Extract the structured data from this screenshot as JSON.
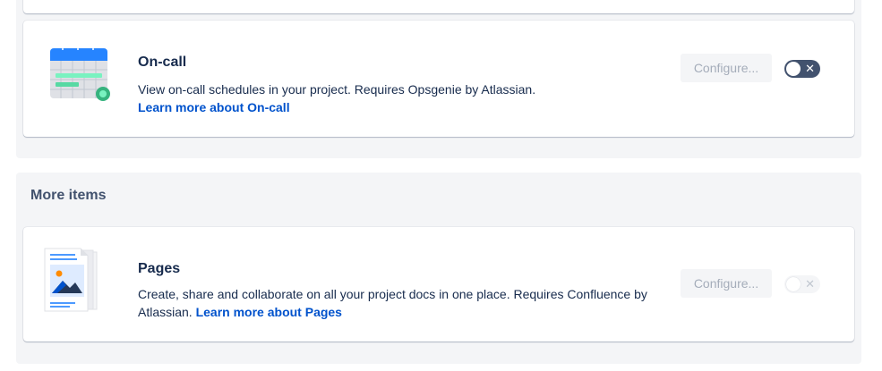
{
  "oncall": {
    "title": "On-call",
    "description": "View on-call schedules in your project. Requires Opsgenie by Atlassian.",
    "link": "Learn more about On-call",
    "configure_label": "Configure...",
    "toggle_icon": "close-icon"
  },
  "more_items": {
    "heading": "More items"
  },
  "pages": {
    "title": "Pages",
    "description": "Create, share and collaborate on all your project docs in one place. Requires Confluence by Atlassian.",
    "link": "Learn more about Pages",
    "configure_label": "Configure...",
    "toggle_icon": "close-icon"
  },
  "colors": {
    "link": "#0052cc",
    "toggle_dark": "#42526e",
    "section_bg": "#f4f5f7"
  }
}
